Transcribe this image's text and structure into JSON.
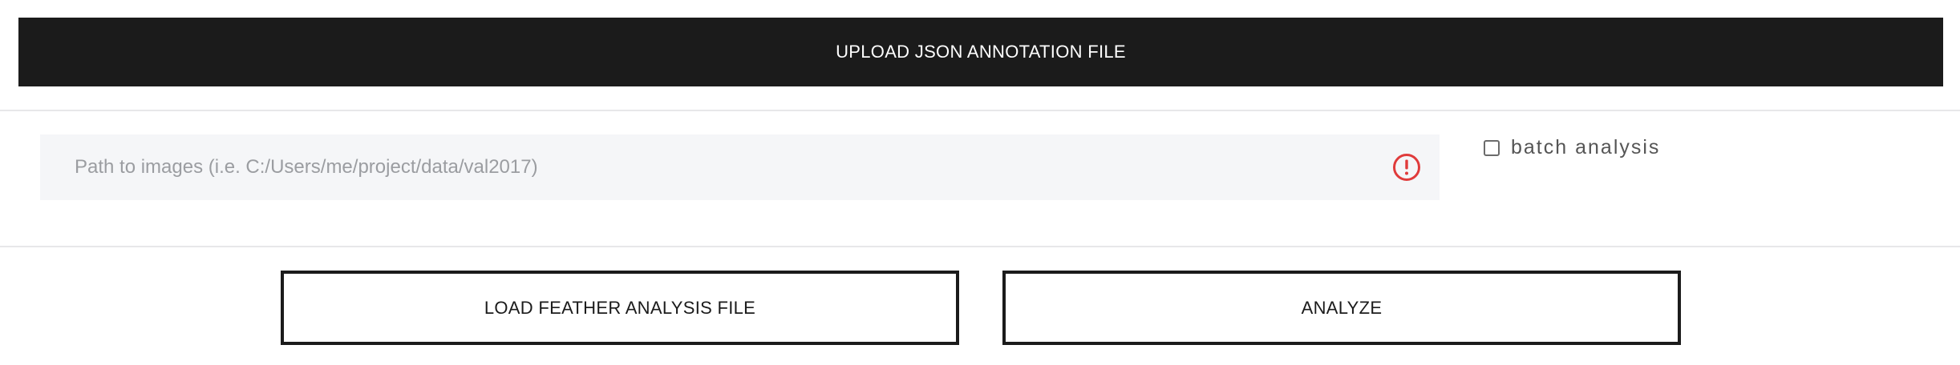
{
  "upload": {
    "label": "UPLOAD JSON ANNOTATION FILE"
  },
  "path_input": {
    "placeholder": "Path to images (i.e. C:/Users/me/project/data/val2017)",
    "value": "",
    "status_icon": "warning-circle-icon",
    "status_color": "#e03b3b"
  },
  "batch": {
    "label": "batch analysis",
    "checked": false
  },
  "actions": {
    "load_label": "LOAD FEATHER ANALYSIS FILE",
    "analyze_label": "ANALYZE"
  }
}
